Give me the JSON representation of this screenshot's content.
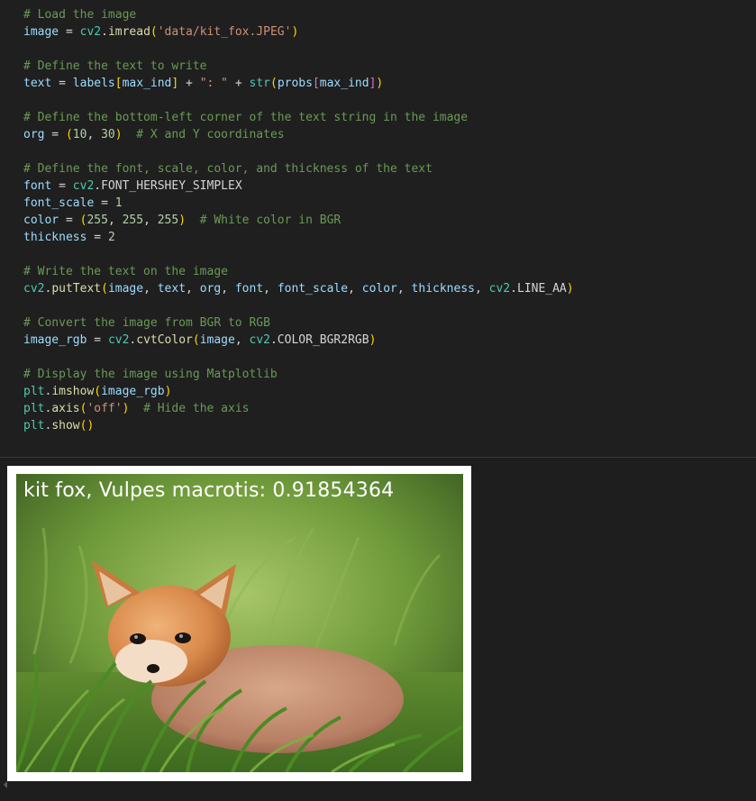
{
  "code_lines": [
    [
      {
        "t": "# Load the image",
        "c": "c"
      }
    ],
    [
      {
        "t": "image",
        "c": "v"
      },
      {
        "t": " = ",
        "c": "p"
      },
      {
        "t": "cv2",
        "c": "m"
      },
      {
        "t": ".",
        "c": "p"
      },
      {
        "t": "imread",
        "c": "f"
      },
      {
        "t": "(",
        "c": "b1"
      },
      {
        "t": "'data/kit_fox.JPEG'",
        "c": "s"
      },
      {
        "t": ")",
        "c": "b1"
      }
    ],
    [],
    [
      {
        "t": "# Define the text to write",
        "c": "c"
      }
    ],
    [
      {
        "t": "text",
        "c": "v"
      },
      {
        "t": " = ",
        "c": "p"
      },
      {
        "t": "labels",
        "c": "v"
      },
      {
        "t": "[",
        "c": "b1"
      },
      {
        "t": "max_ind",
        "c": "v"
      },
      {
        "t": "]",
        "c": "b1"
      },
      {
        "t": " + ",
        "c": "p"
      },
      {
        "t": "\": \"",
        "c": "s"
      },
      {
        "t": " + ",
        "c": "p"
      },
      {
        "t": "str",
        "c": "m"
      },
      {
        "t": "(",
        "c": "b1"
      },
      {
        "t": "probs",
        "c": "v"
      },
      {
        "t": "[",
        "c": "b2"
      },
      {
        "t": "max_ind",
        "c": "v"
      },
      {
        "t": "]",
        "c": "b2"
      },
      {
        "t": ")",
        "c": "b1"
      }
    ],
    [],
    [
      {
        "t": "# Define the bottom-left corner of the text string in the image",
        "c": "c"
      }
    ],
    [
      {
        "t": "org",
        "c": "v"
      },
      {
        "t": " = ",
        "c": "p"
      },
      {
        "t": "(",
        "c": "b1"
      },
      {
        "t": "10",
        "c": "n"
      },
      {
        "t": ", ",
        "c": "p"
      },
      {
        "t": "30",
        "c": "n"
      },
      {
        "t": ")",
        "c": "b1"
      },
      {
        "t": "  ",
        "c": "p"
      },
      {
        "t": "# X and Y coordinates",
        "c": "c"
      }
    ],
    [],
    [
      {
        "t": "# Define the font, scale, color, and thickness of the text",
        "c": "c"
      }
    ],
    [
      {
        "t": "font",
        "c": "v"
      },
      {
        "t": " = ",
        "c": "p"
      },
      {
        "t": "cv2",
        "c": "m"
      },
      {
        "t": ".FONT_HERSHEY_SIMPLEX",
        "c": "p"
      }
    ],
    [
      {
        "t": "font_scale",
        "c": "v"
      },
      {
        "t": " = ",
        "c": "p"
      },
      {
        "t": "1",
        "c": "n"
      }
    ],
    [
      {
        "t": "color",
        "c": "v"
      },
      {
        "t": " = ",
        "c": "p"
      },
      {
        "t": "(",
        "c": "b1"
      },
      {
        "t": "255",
        "c": "n"
      },
      {
        "t": ", ",
        "c": "p"
      },
      {
        "t": "255",
        "c": "n"
      },
      {
        "t": ", ",
        "c": "p"
      },
      {
        "t": "255",
        "c": "n"
      },
      {
        "t": ")",
        "c": "b1"
      },
      {
        "t": "  ",
        "c": "p"
      },
      {
        "t": "# White color in BGR",
        "c": "c"
      }
    ],
    [
      {
        "t": "thickness",
        "c": "v"
      },
      {
        "t": " = ",
        "c": "p"
      },
      {
        "t": "2",
        "c": "n"
      }
    ],
    [],
    [
      {
        "t": "# Write the text on the image",
        "c": "c"
      }
    ],
    [
      {
        "t": "cv2",
        "c": "m"
      },
      {
        "t": ".",
        "c": "p"
      },
      {
        "t": "putText",
        "c": "f"
      },
      {
        "t": "(",
        "c": "b1"
      },
      {
        "t": "image",
        "c": "v"
      },
      {
        "t": ", ",
        "c": "p"
      },
      {
        "t": "text",
        "c": "v"
      },
      {
        "t": ", ",
        "c": "p"
      },
      {
        "t": "org",
        "c": "v"
      },
      {
        "t": ", ",
        "c": "p"
      },
      {
        "t": "font",
        "c": "v"
      },
      {
        "t": ", ",
        "c": "p"
      },
      {
        "t": "font_scale",
        "c": "v"
      },
      {
        "t": ", ",
        "c": "p"
      },
      {
        "t": "color",
        "c": "v"
      },
      {
        "t": ", ",
        "c": "p"
      },
      {
        "t": "thickness",
        "c": "v"
      },
      {
        "t": ", ",
        "c": "p"
      },
      {
        "t": "cv2",
        "c": "m"
      },
      {
        "t": ".LINE_AA",
        "c": "p"
      },
      {
        "t": ")",
        "c": "b1"
      }
    ],
    [],
    [
      {
        "t": "# Convert the image from BGR to RGB",
        "c": "c"
      }
    ],
    [
      {
        "t": "image_rgb",
        "c": "v"
      },
      {
        "t": " = ",
        "c": "p"
      },
      {
        "t": "cv2",
        "c": "m"
      },
      {
        "t": ".",
        "c": "p"
      },
      {
        "t": "cvtColor",
        "c": "f"
      },
      {
        "t": "(",
        "c": "b1"
      },
      {
        "t": "image",
        "c": "v"
      },
      {
        "t": ", ",
        "c": "p"
      },
      {
        "t": "cv2",
        "c": "m"
      },
      {
        "t": ".COLOR_BGR2RGB",
        "c": "p"
      },
      {
        "t": ")",
        "c": "b1"
      }
    ],
    [],
    [
      {
        "t": "# Display the image using Matplotlib",
        "c": "c"
      }
    ],
    [
      {
        "t": "plt",
        "c": "m"
      },
      {
        "t": ".",
        "c": "p"
      },
      {
        "t": "imshow",
        "c": "f"
      },
      {
        "t": "(",
        "c": "b1"
      },
      {
        "t": "image_rgb",
        "c": "v"
      },
      {
        "t": ")",
        "c": "b1"
      }
    ],
    [
      {
        "t": "plt",
        "c": "m"
      },
      {
        "t": ".",
        "c": "p"
      },
      {
        "t": "axis",
        "c": "f"
      },
      {
        "t": "(",
        "c": "b1"
      },
      {
        "t": "'off'",
        "c": "s"
      },
      {
        "t": ")",
        "c": "b1"
      },
      {
        "t": "  ",
        "c": "p"
      },
      {
        "t": "# Hide the axis",
        "c": "c"
      }
    ],
    [
      {
        "t": "plt",
        "c": "m"
      },
      {
        "t": ".",
        "c": "p"
      },
      {
        "t": "show",
        "c": "f"
      },
      {
        "t": "()",
        "c": "b1"
      }
    ]
  ],
  "output": {
    "overlay_text": "kit fox, Vulpes macrotis: 0.91854364",
    "image_subject": "kit-fox-in-grass-photo"
  },
  "colors": {
    "editor_bg": "#1f1f1f",
    "comment": "#6a9955",
    "variable": "#9cdcfe",
    "string": "#ce9178",
    "number": "#b5cea8",
    "module": "#4ec9b0",
    "function": "#dcdcaa",
    "bracket": "#ffd700"
  }
}
